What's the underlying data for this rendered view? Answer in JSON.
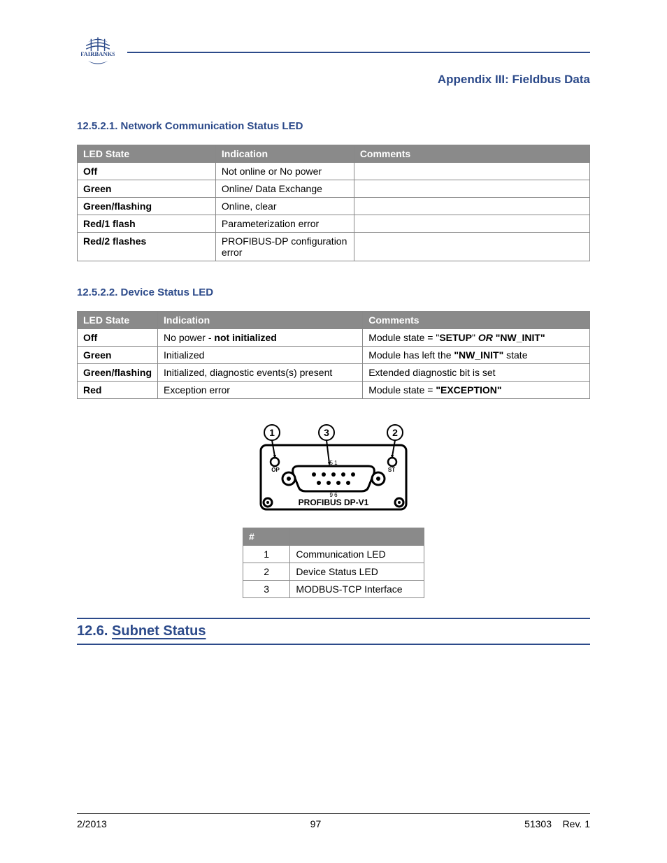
{
  "appendix_title": "Appendix III: Fieldbus Data",
  "section_a": {
    "heading": "12.5.2.1. Network Communication Status LED",
    "cols": [
      "LED State",
      "Indication",
      "Comments"
    ],
    "rows": [
      {
        "state": "Off",
        "indication": "Not online or No power",
        "comments": ""
      },
      {
        "state": "Green",
        "indication": "Online/ Data Exchange",
        "comments": ""
      },
      {
        "state": "Green/flashing",
        "indication": "Online, clear",
        "comments": ""
      },
      {
        "state": "Red/1 flash",
        "indication": "Parameterization error",
        "comments": ""
      },
      {
        "state": "Red/2 flashes",
        "indication": "PROFIBUS-DP configuration error",
        "comments": ""
      }
    ]
  },
  "section_b": {
    "heading": "12.5.2.2. Device Status LED",
    "cols": [
      "LED State",
      "Indication",
      "Comments"
    ],
    "rows": [
      {
        "state": "Off",
        "ind_pre": "No power  -",
        "ind_bold": "   not initialized",
        "comm_pre": "Module state = \"",
        "comm_bold": "SETUP",
        "comm_mid": "\"  ",
        "or": "OR",
        "comm_post": "  \"NW_INIT\""
      },
      {
        "state": "Green",
        "ind_pre": "Initialized",
        "ind_bold": "",
        "comm_pre": "Module has left the ",
        "comm_bold": "\"NW_INIT\"",
        "comm_mid": " state",
        "or": "",
        "comm_post": ""
      },
      {
        "state": "Green/flashing",
        "ind_pre": "Initialized, diagnostic events(s) present",
        "ind_bold": "",
        "comm_pre": "Extended diagnostic bit is set",
        "comm_bold": "",
        "comm_mid": "",
        "or": "",
        "comm_post": ""
      },
      {
        "state": "Red",
        "ind_pre": "Exception error",
        "ind_bold": "",
        "comm_pre": "Module state = ",
        "comm_bold": "\"EXCEPTION\"",
        "comm_mid": "",
        "or": "",
        "comm_post": ""
      }
    ]
  },
  "diagram": {
    "label_br_left": "OP",
    "label_br_right": "ST",
    "title": "PROFIBUS  DP-V1",
    "top_dots": "5                1",
    "bot_dots": "9            6",
    "n1": "1",
    "n2": "2",
    "n3": "3"
  },
  "mini": {
    "cols": [
      "#",
      ""
    ],
    "rows": [
      {
        "n": "1",
        "t": "Communication LED"
      },
      {
        "n": "2",
        "t": "Device Status LED"
      },
      {
        "n": "3",
        "t": "MODBUS-TCP Interface"
      }
    ]
  },
  "section_num": {
    "num": "12.6.  ",
    "title": "Subnet Status"
  },
  "footer": {
    "left": "2/2013",
    "center": "97",
    "right_code": "51303",
    "right_rev": "Rev. 1"
  }
}
